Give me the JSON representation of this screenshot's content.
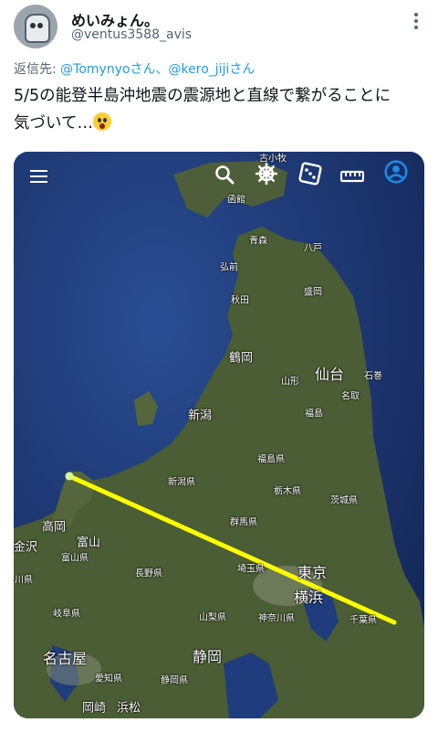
{
  "tweet": {
    "display_name": "めいみょん。",
    "handle": "@ventus3588_avis",
    "reply_prefix": "返信先: ",
    "reply_mentions": "@Tomynyoさん、@kero_jijiさん",
    "text_line1": "5/5の能登半島沖地震の震源地と直線で繋がることに",
    "text_line2": "気づいて…",
    "emoji": "face-screaming-icon"
  },
  "map": {
    "toolbar": [
      "menu-icon",
      "search-icon",
      "ship-wheel-icon",
      "dice-icon",
      "ruler-icon",
      "account-icon"
    ],
    "labels": {
      "furukomaki": "古小牧",
      "hakodate": "函館",
      "aomori": "青森",
      "hachinohe": "八戸",
      "hirosaki": "弘前",
      "akita": "秋田",
      "morioka": "盛岡",
      "tsuruoka": "鶴岡",
      "yamagata": "山形",
      "sendai": "仙台",
      "ishinomaki": "石巻",
      "natori": "名取",
      "fukushima": "福島",
      "niigata": "新潟",
      "fukushima_ken": "福島県",
      "niigata_ken": "新潟県",
      "tochigi_ken": "栃木県",
      "ibaraki_ken": "茨城県",
      "gunma_ken": "群馬県",
      "takaoka": "高岡",
      "toyama": "富山",
      "kanazawa": "金沢",
      "toyama_ken": "富山県",
      "nagano_ken": "長野県",
      "ishikawa": "川県",
      "saitama_ken": "埼玉県",
      "tokyo": "東京",
      "yokohama": "横浜",
      "chiba_ken": "千葉県",
      "gifu_ken": "岐阜県",
      "yamanashi_ken": "山梨県",
      "kanagawa_ken": "神奈川県",
      "nagoya": "名古屋",
      "shizuoka": "静岡",
      "aichi_ken": "愛知県",
      "shizuoka_ken": "静岡県",
      "okazaki": "岡崎",
      "hamamatsu": "浜松"
    },
    "line_color": "#ffff00",
    "land_color": "#4b5d34",
    "sea_color": "#1d3a78"
  }
}
